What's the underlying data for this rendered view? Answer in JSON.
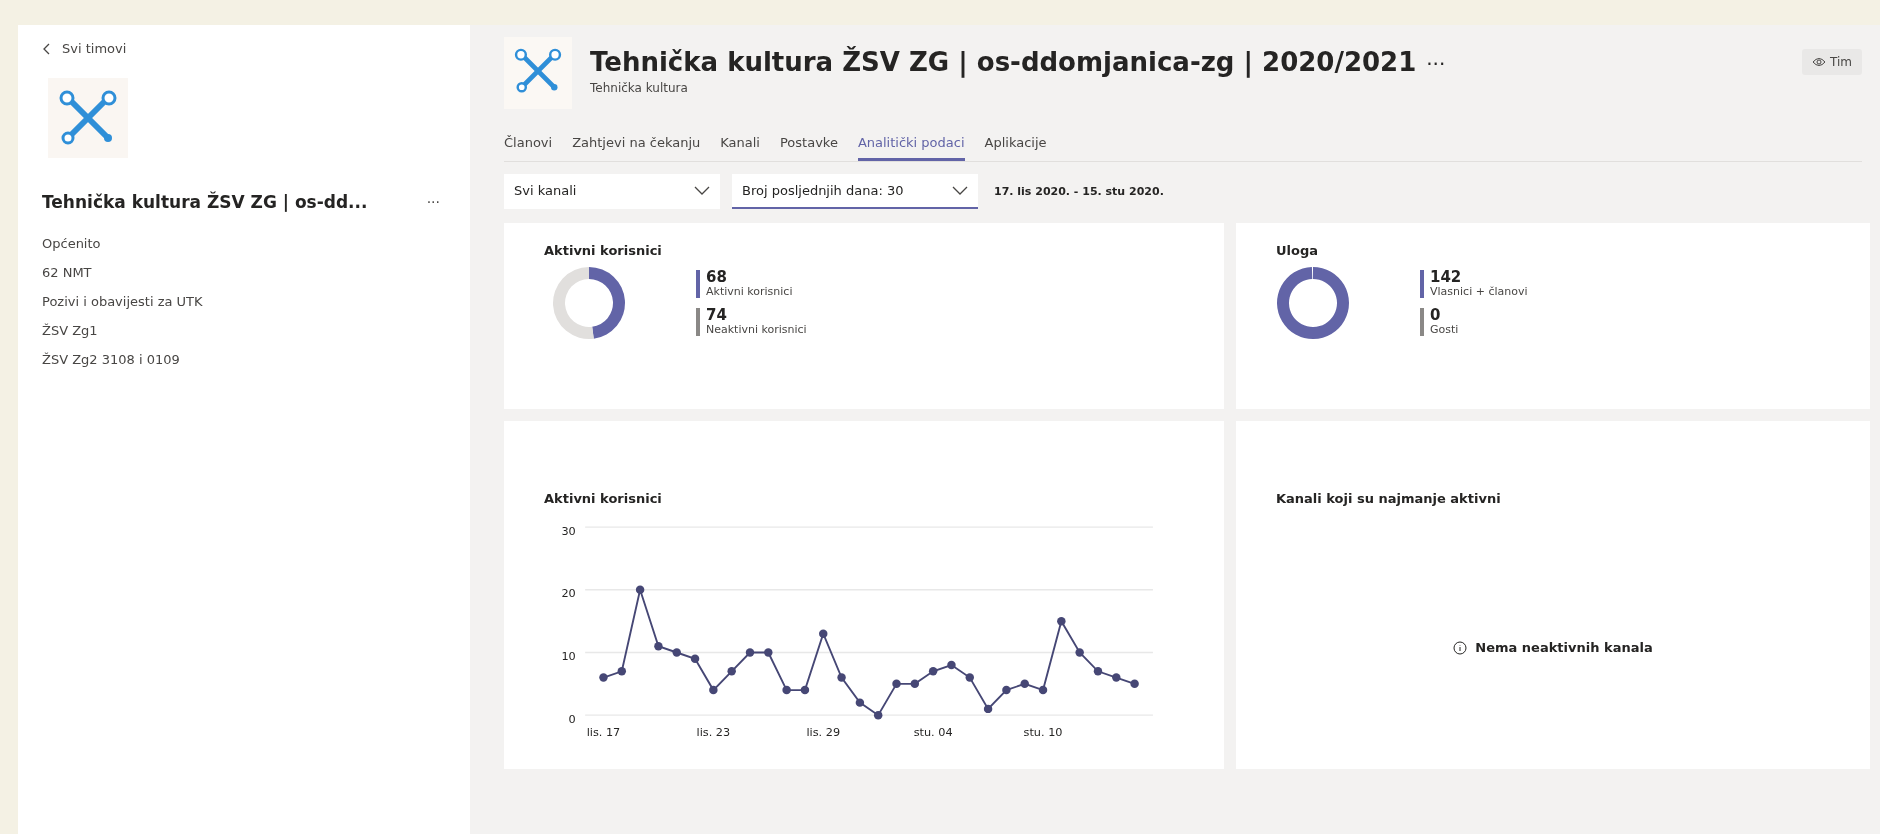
{
  "sidebar": {
    "back_link": "Svi timovi",
    "team_name": "Tehnička kultura ŽSV ZG | os-dd...",
    "more": "···",
    "channels": [
      {
        "label": "Općenito"
      },
      {
        "label": "62 NMT"
      },
      {
        "label": "Pozivi i obavijesti za UTK"
      },
      {
        "label": "ŽSV Zg1"
      },
      {
        "label": "ŽSV Zg2 3108 i 0109"
      }
    ]
  },
  "header": {
    "title": "Tehnička kultura ŽSV ZG | os-ddomjanica-zg | 2020/2021",
    "more": "···",
    "subtitle": "Tehnička kultura",
    "team_button": "Tim"
  },
  "tabs": [
    {
      "label": "Članovi",
      "selected": false
    },
    {
      "label": "Zahtjevi na čekanju",
      "selected": false
    },
    {
      "label": "Kanali",
      "selected": false
    },
    {
      "label": "Postavke",
      "selected": false
    },
    {
      "label": "Analitički podaci",
      "selected": true
    },
    {
      "label": "Aplikacije",
      "selected": false
    }
  ],
  "filters": {
    "channel_dropdown": {
      "value": "Svi kanali",
      "focused": false
    },
    "days_dropdown": {
      "value": "Broj posljednjih dana: 30",
      "focused": true
    },
    "date_range": "17. lis 2020. - 15. stu 2020."
  },
  "cards": [
    {
      "title": "Aktivni korisnici",
      "legend": [
        {
          "value": "68",
          "label": "Aktivni korisnici",
          "color": "#6264a7"
        },
        {
          "value": "74",
          "label": "Neaktivni korisnici",
          "color": "#8a8886"
        }
      ]
    },
    {
      "title": "Uloga",
      "legend": [
        {
          "value": "142",
          "label": "Vlasnici + članovi",
          "color": "#6264a7"
        },
        {
          "value": "0",
          "label": "Gosti",
          "color": "#8a8886"
        }
      ]
    }
  ],
  "activity_chart": {
    "title": "Aktivni korisnici",
    "chart_data": {
      "type": "line",
      "x": [
        "2020-10-17",
        "2020-10-18",
        "2020-10-19",
        "2020-10-20",
        "2020-10-21",
        "2020-10-22",
        "2020-10-23",
        "2020-10-24",
        "2020-10-25",
        "2020-10-26",
        "2020-10-27",
        "2020-10-28",
        "2020-10-29",
        "2020-10-30",
        "2020-10-31",
        "2020-11-01",
        "2020-11-02",
        "2020-11-03",
        "2020-11-04",
        "2020-11-05",
        "2020-11-06",
        "2020-11-07",
        "2020-11-08",
        "2020-11-09",
        "2020-11-10",
        "2020-11-11",
        "2020-11-12",
        "2020-11-13",
        "2020-11-14",
        "2020-11-15"
      ],
      "series": [
        {
          "color": "#464775",
          "marker": "circle",
          "values": [
            6,
            7,
            20,
            11,
            10,
            9,
            4,
            7,
            10,
            10,
            4,
            4,
            13,
            6,
            2,
            0,
            5,
            5,
            7,
            8,
            6,
            1,
            4,
            5,
            4,
            15,
            10,
            7,
            6,
            5
          ]
        }
      ],
      "xlim": [
        "2020-10-16",
        "2020-11-16"
      ],
      "ylim": [
        0,
        30
      ],
      "yticks": [
        0,
        10,
        20,
        30
      ],
      "xticks": [
        {
          "value": "2020-10-17",
          "label": "lis. 17"
        },
        {
          "value": "2020-10-23",
          "label": "lis. 23"
        },
        {
          "value": "2020-10-29",
          "label": "lis. 29"
        },
        {
          "value": "2020-11-04",
          "label": "stu. 04"
        },
        {
          "value": "2020-11-10",
          "label": "stu. 10"
        }
      ]
    }
  },
  "inactive_channels": {
    "title": "Kanali koji su najmanje aktivni",
    "message": "Nema neaktivnih kanala"
  }
}
